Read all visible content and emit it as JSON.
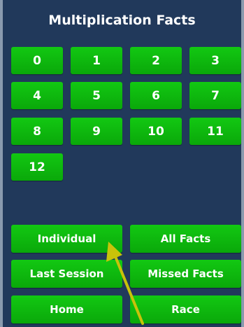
{
  "header": {
    "title": "Multiplication Facts"
  },
  "number_buttons": [
    "0",
    "1",
    "2",
    "3",
    "4",
    "5",
    "6",
    "7",
    "8",
    "9",
    "10",
    "11",
    "12"
  ],
  "mode_buttons": {
    "individual": "Individual",
    "all_facts": "All Facts",
    "last_session": "Last Session",
    "missed_facts": "Missed Facts",
    "home": "Home",
    "race": "Race"
  },
  "colors": {
    "background": "#21395b",
    "button": "#0fb80f",
    "annotation_arrow": "#c8c20a"
  }
}
